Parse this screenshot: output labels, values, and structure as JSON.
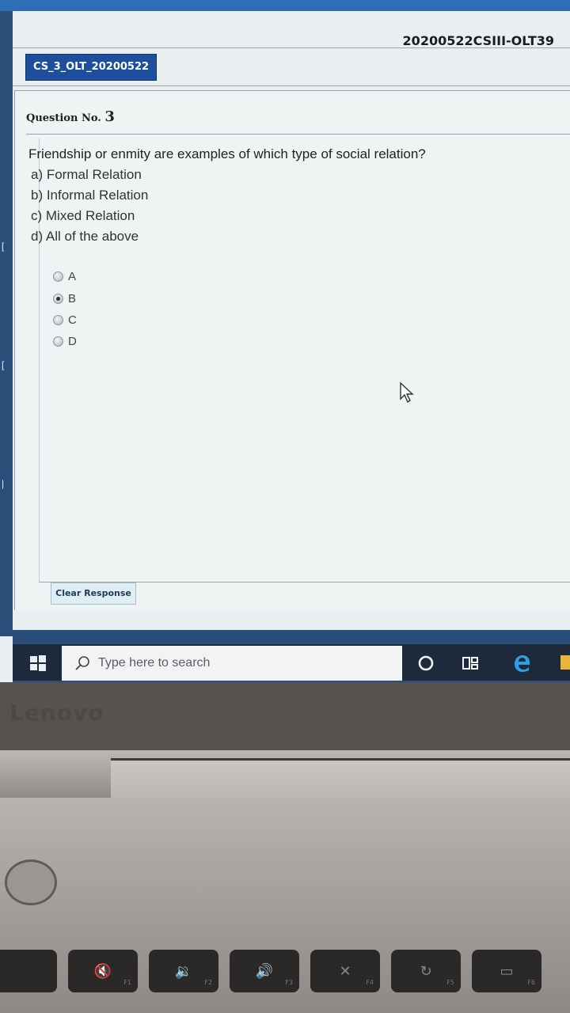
{
  "exam": {
    "id": "20200522CSIII-OLT39",
    "section_tab": "CS_3_OLT_20200522"
  },
  "question": {
    "label": "Question No.",
    "number": "3",
    "text": "Friendship or enmity are examples of which type of social relation?",
    "options": [
      "a) Formal Relation",
      "b) Informal Relation",
      "c) Mixed Relation",
      "d) All of the above"
    ]
  },
  "answers": [
    {
      "label": "A",
      "checked": false
    },
    {
      "label": "B",
      "checked": true
    },
    {
      "label": "C",
      "checked": false
    },
    {
      "label": "D",
      "checked": false
    }
  ],
  "buttons": {
    "clear_response": "Clear Response"
  },
  "taskbar": {
    "search_placeholder": "Type here to search"
  },
  "laptop": {
    "brand": "Lenovo",
    "fn_keys": [
      "F1",
      "F2",
      "F3",
      "F4",
      "F5",
      "F6"
    ]
  },
  "colors": {
    "tab_blue": "#1e4f9d",
    "taskbar": "#1c2a3c"
  }
}
